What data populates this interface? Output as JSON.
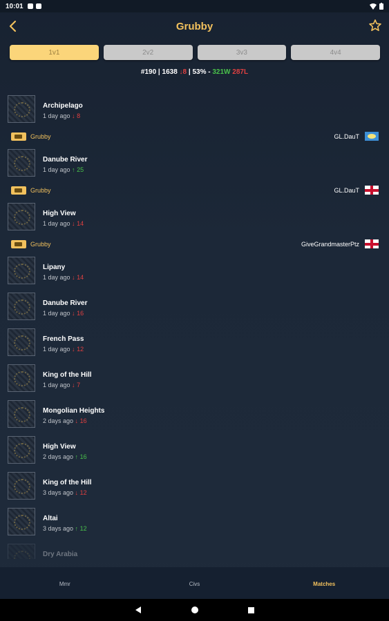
{
  "status_bar": {
    "time": "10:01"
  },
  "header": {
    "title": "Grubby"
  },
  "tabs": [
    {
      "label": "1v1",
      "active": true
    },
    {
      "label": "2v2",
      "active": false
    },
    {
      "label": "3v3",
      "active": false
    },
    {
      "label": "4v4",
      "active": false
    }
  ],
  "stats": {
    "rank": "#190",
    "rating": "1638",
    "rating_change": "8",
    "winrate": "53%",
    "wins": "321W",
    "losses": "287L"
  },
  "matches": [
    {
      "map": "Archipelago",
      "time": "1 day ago",
      "change": "8",
      "dir": "down",
      "expanded": true,
      "player": "Grubby",
      "opponent": "GL.DauT",
      "opponent_flag": "blue"
    },
    {
      "map": "Danube River",
      "time": "1 day ago",
      "change": "25",
      "dir": "up",
      "expanded": true,
      "player": "Grubby",
      "opponent": "GL.DauT",
      "opponent_flag": "eng"
    },
    {
      "map": "High View",
      "time": "1 day ago",
      "change": "14",
      "dir": "down",
      "expanded": true,
      "player": "Grubby",
      "opponent": "GiveGrandmasterPtz",
      "opponent_flag": "eng"
    },
    {
      "map": "Lipany",
      "time": "1 day ago",
      "change": "14",
      "dir": "down",
      "expanded": false
    },
    {
      "map": "Danube River",
      "time": "1 day ago",
      "change": "16",
      "dir": "down",
      "expanded": false
    },
    {
      "map": "French Pass",
      "time": "1 day ago",
      "change": "12",
      "dir": "down",
      "expanded": false
    },
    {
      "map": "King of the Hill",
      "time": "1 day ago",
      "change": "7",
      "dir": "down",
      "expanded": false
    },
    {
      "map": "Mongolian Heights",
      "time": "2 days ago",
      "change": "16",
      "dir": "down",
      "expanded": false
    },
    {
      "map": "High View",
      "time": "2 days ago",
      "change": "16",
      "dir": "up",
      "expanded": false
    },
    {
      "map": "King of the Hill",
      "time": "3 days ago",
      "change": "12",
      "dir": "down",
      "expanded": false
    },
    {
      "map": "Altai",
      "time": "3 days ago",
      "change": "12",
      "dir": "up",
      "expanded": false
    },
    {
      "map": "Dry Arabia",
      "time": "",
      "change": "",
      "dir": "",
      "expanded": false
    }
  ],
  "bottom_nav": [
    {
      "label": "Mmr",
      "icon": "chart-icon",
      "active": false
    },
    {
      "label": "Civs",
      "icon": "pie-icon",
      "active": false
    },
    {
      "label": "Matches",
      "icon": "history-icon",
      "active": true
    }
  ],
  "colors": {
    "accent": "#f2c15d",
    "up": "#49c14a",
    "down": "#e04040",
    "tab_active": "#fbd57a"
  }
}
